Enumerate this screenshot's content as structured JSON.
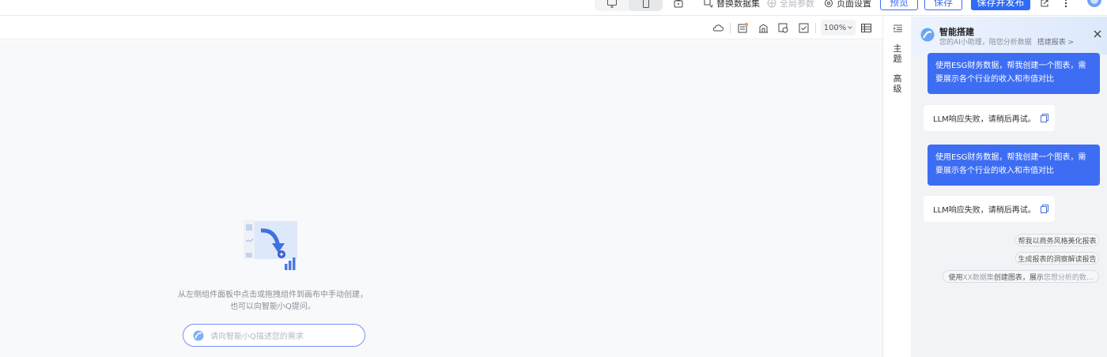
{
  "topbar": {
    "device_toggle": {
      "desktop_icon": "desktop-icon",
      "mobile_icon": "mobile-icon",
      "active": "mobile"
    },
    "items": [
      {
        "icon": "lock-box-icon",
        "label": ""
      },
      {
        "icon": "dataset-swap-icon",
        "label": "替换数据集"
      },
      {
        "icon": "global-params-icon",
        "label": "全局参数",
        "disabled": true
      },
      {
        "icon": "gear-icon",
        "label": "页面设置"
      }
    ],
    "preview_label": "预览",
    "save_label": "保存",
    "save_publish_label": "保存并发布",
    "share_icon": "external-link-icon",
    "more_icon": "more-vertical-icon"
  },
  "canvas_toolbar": {
    "icons": [
      "cloud-icon",
      "report-icon",
      "building-icon",
      "style-icon",
      "check-icon"
    ],
    "zoom": "100%",
    "table_icon": "table-icon"
  },
  "canvas": {
    "empty_line1": "从左侧组件面板中点击或拖拽组件到画布中手动创建，",
    "empty_line2": "也可以向智能小Q提问。",
    "ask_placeholder": "请向智能小Q描述您的需求"
  },
  "side_tabs": {
    "collapse_icon": "indent-icon",
    "theme_label": "主题",
    "advanced_label": "高级"
  },
  "ai_panel": {
    "title": "智能搭建",
    "subtitle": "您的AI小助理，陪您分析数据",
    "subtitle_link": "搭建报表 >",
    "messages": [
      {
        "role": "user",
        "text": "使用ESG财务数据，帮我创建一个图表，需要展示各个行业的收入和市值对比"
      },
      {
        "role": "bot",
        "text": "LLM响应失败，请稍后再试。"
      },
      {
        "role": "user",
        "text": "使用ESG财务数据，帮我创建一个图表，需要展示各个行业的收入和市值对比"
      },
      {
        "role": "bot",
        "text": "LLM响应失败，请稍后再试。"
      }
    ],
    "suggestions": [
      "帮我以商务风格美化报表",
      "生成报表的洞察解读报告"
    ],
    "suggestion3": {
      "p1": "使用 ",
      "p2": "XX数据集",
      "p3": " 创建图表，展示 ",
      "p4": "您想分析的数..."
    }
  },
  "colors": {
    "primary": "#2f6bf6",
    "user_bubble": "#3d6df2",
    "panel_bg": "#f1f3f7",
    "canvas_bg": "#f8f9fa"
  }
}
